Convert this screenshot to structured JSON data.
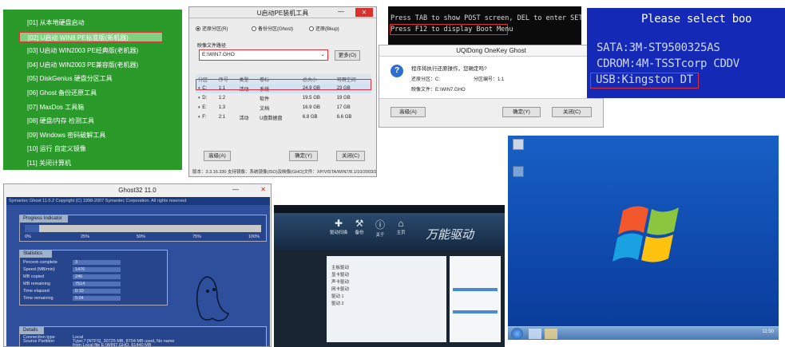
{
  "panel1": {
    "items": [
      "[01] 从本地硬盘启动",
      "[02] U启动 WIN8 PE标准版(新机器)",
      "[03] U启动 WIN2003 PE经典版(老机器)",
      "[04] U启动 WIN2003 PE兼容版(老机器)",
      "[05] DiskGenius 硬盘分区工具",
      "[06] Ghost 备份还原工具",
      "[07] MaxDos 工具箱",
      "[08] 硬盘/内存 检测工具",
      "[09] Windows 密码破解工具",
      "[10] 运行 自定义镜像",
      "[11] 关闭计算机"
    ],
    "selected_index": 1
  },
  "panel2": {
    "title": "U启动PE装机工具",
    "radios": [
      "还原分区(R)",
      "备份分区(Ghost)",
      "还原(Bkup)"
    ],
    "file_label": "映像文件路径",
    "file_value": "E:\\WIN7.GHO",
    "browse": "更多(O)",
    "headers": [
      "分区",
      "序号",
      "类型",
      "卷标",
      "总大小",
      "可用空间"
    ],
    "rows": [
      [
        "C:",
        "1:1",
        "活动",
        "系统",
        "24.9 GB",
        "23 GB"
      ],
      [
        "D:",
        "1:2",
        "",
        "软件",
        "19.5 GB",
        "19 GB"
      ],
      [
        "E:",
        "1:3",
        "",
        "文档",
        "16.9 GB",
        "17 GB"
      ],
      [
        "F:",
        "2:1",
        "活动",
        "U盘数据盘",
        "6.8 GB",
        "6.6 GB"
      ]
    ],
    "buttons": [
      "高级(A)",
      "确定(Y)",
      "关闭(C)"
    ],
    "status": "版本：3.3.16.330   支持镜像：系统镜像(ISO)及映像(GHO)文件：XP/VISTA/WIN7/8.1/10/2003/2008"
  },
  "panel3": {
    "post1": "Press TAB to show POST screen, DEL to enter SETUP",
    "post2": "Press F12 to display Boot Menu",
    "dialog_title": "UQiDong OneKey Ghost",
    "question": "程序将执行还原操作，您确定吗?",
    "l1a": "还原分区：C:",
    "l1b": "分区编号：1:1",
    "l2": "映像文件：E:\\WIN7.GHO",
    "b1": "高级(A)",
    "b2": "确定(Y)",
    "b3": "关闭(C)"
  },
  "panel4": {
    "line1": "Please select boo",
    "line2": "SATA:3M-ST9500325AS",
    "line3": "CDROM:4M-TSSTcorp CDDV",
    "line4": "USB:Kingston DT"
  },
  "panel5": {
    "title": "Ghost32 11.0",
    "banner": "Symantec Ghost 11.0.2  Copyright (C) 1998-2007 Symantec Corporation. All rights reserved.",
    "progress_label": "Progress Indicator",
    "ticks": [
      "0%",
      "25%",
      "50%",
      "75%",
      "100%"
    ],
    "progress": 0.06,
    "stats_label": "Statistics",
    "stats": [
      [
        "Percent complete",
        "3"
      ],
      [
        "Speed (MB/min)",
        "1476"
      ],
      [
        "MB copied",
        "246"
      ],
      [
        "MB remaining",
        "7514"
      ],
      [
        "Time elapsed",
        "0:10"
      ],
      [
        "Time remaining",
        "5:04"
      ]
    ],
    "details_label": "Details",
    "details": [
      [
        "Connection type",
        "Local"
      ],
      [
        "Source Partition",
        "Type:7 [NTFS], 30725 MB, 8704 MB used, No name"
      ],
      [
        "",
        "from Local file E:\\WIN7.GHO, 61440 MB"
      ],
      [
        "Target Partition",
        "Type:7 [NTFS], 25601 MB"
      ]
    ]
  },
  "panel6": {
    "brand": "万能驱动",
    "btn_labels": [
      "驱动扫描",
      "备份",
      "关于",
      "主页"
    ],
    "list": [
      "主板驱动",
      "显卡驱动",
      "声卡驱动",
      "网卡驱动",
      "驱动 1",
      "驱动 2"
    ]
  },
  "panel7": {
    "taskbar_time": "11:50"
  },
  "colors": {
    "highlight": "#e0303a",
    "menu_green": "#2a9a2a",
    "bios_blue": "#1429b5",
    "ghost_blue": "#2e4f9c"
  }
}
